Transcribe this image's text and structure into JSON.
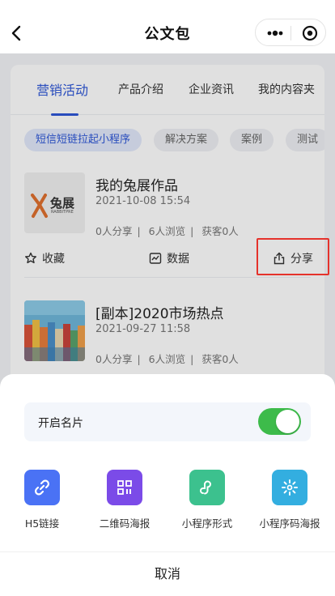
{
  "navbar": {
    "title": "公文包"
  },
  "tabs": [
    {
      "label": "营销活动",
      "active": true
    },
    {
      "label": "产品介绍",
      "active": false
    },
    {
      "label": "企业资讯",
      "active": false
    },
    {
      "label": "我的内容夹",
      "active": false
    }
  ],
  "chips": [
    {
      "label": "短信短链拉起小程序",
      "active": true
    },
    {
      "label": "解决方案",
      "active": false
    },
    {
      "label": "案例",
      "active": false
    },
    {
      "label": "测试",
      "active": false
    }
  ],
  "articles": [
    {
      "title": "我的兔展作品",
      "date": "2021-10-08 15:54",
      "shares": "0人分享",
      "views": "6人浏览",
      "customers": "获客0人",
      "thumb_logo_text": "兔展",
      "thumb_logo_sub": "RABBITPRE"
    },
    {
      "title": "[副本]2020市场热点",
      "date": "2021-09-27 11:58",
      "shares": "0人分享",
      "views": "6人浏览",
      "customers": "获客0人"
    }
  ],
  "actions": {
    "favorite": "收藏",
    "data": "数据",
    "share": "分享"
  },
  "stats_separator": "|",
  "sheet": {
    "toggle_label": "开启名片",
    "toggle_on": true,
    "items": [
      {
        "label": "H5链接",
        "icon": "link-icon",
        "color": "#4a72f5"
      },
      {
        "label": "二维码海报",
        "icon": "qrcode-icon",
        "color": "#7b4be8"
      },
      {
        "label": "小程序形式",
        "icon": "miniprogram-icon",
        "color": "#3cc18e"
      },
      {
        "label": "小程序码海报",
        "icon": "miniprogram-code-icon",
        "color": "#33aee0"
      }
    ],
    "cancel_label": "取消"
  },
  "colors": {
    "accent": "#2e57d8",
    "highlight_box": "#e5322b",
    "switch_on": "#3dbb4a"
  }
}
